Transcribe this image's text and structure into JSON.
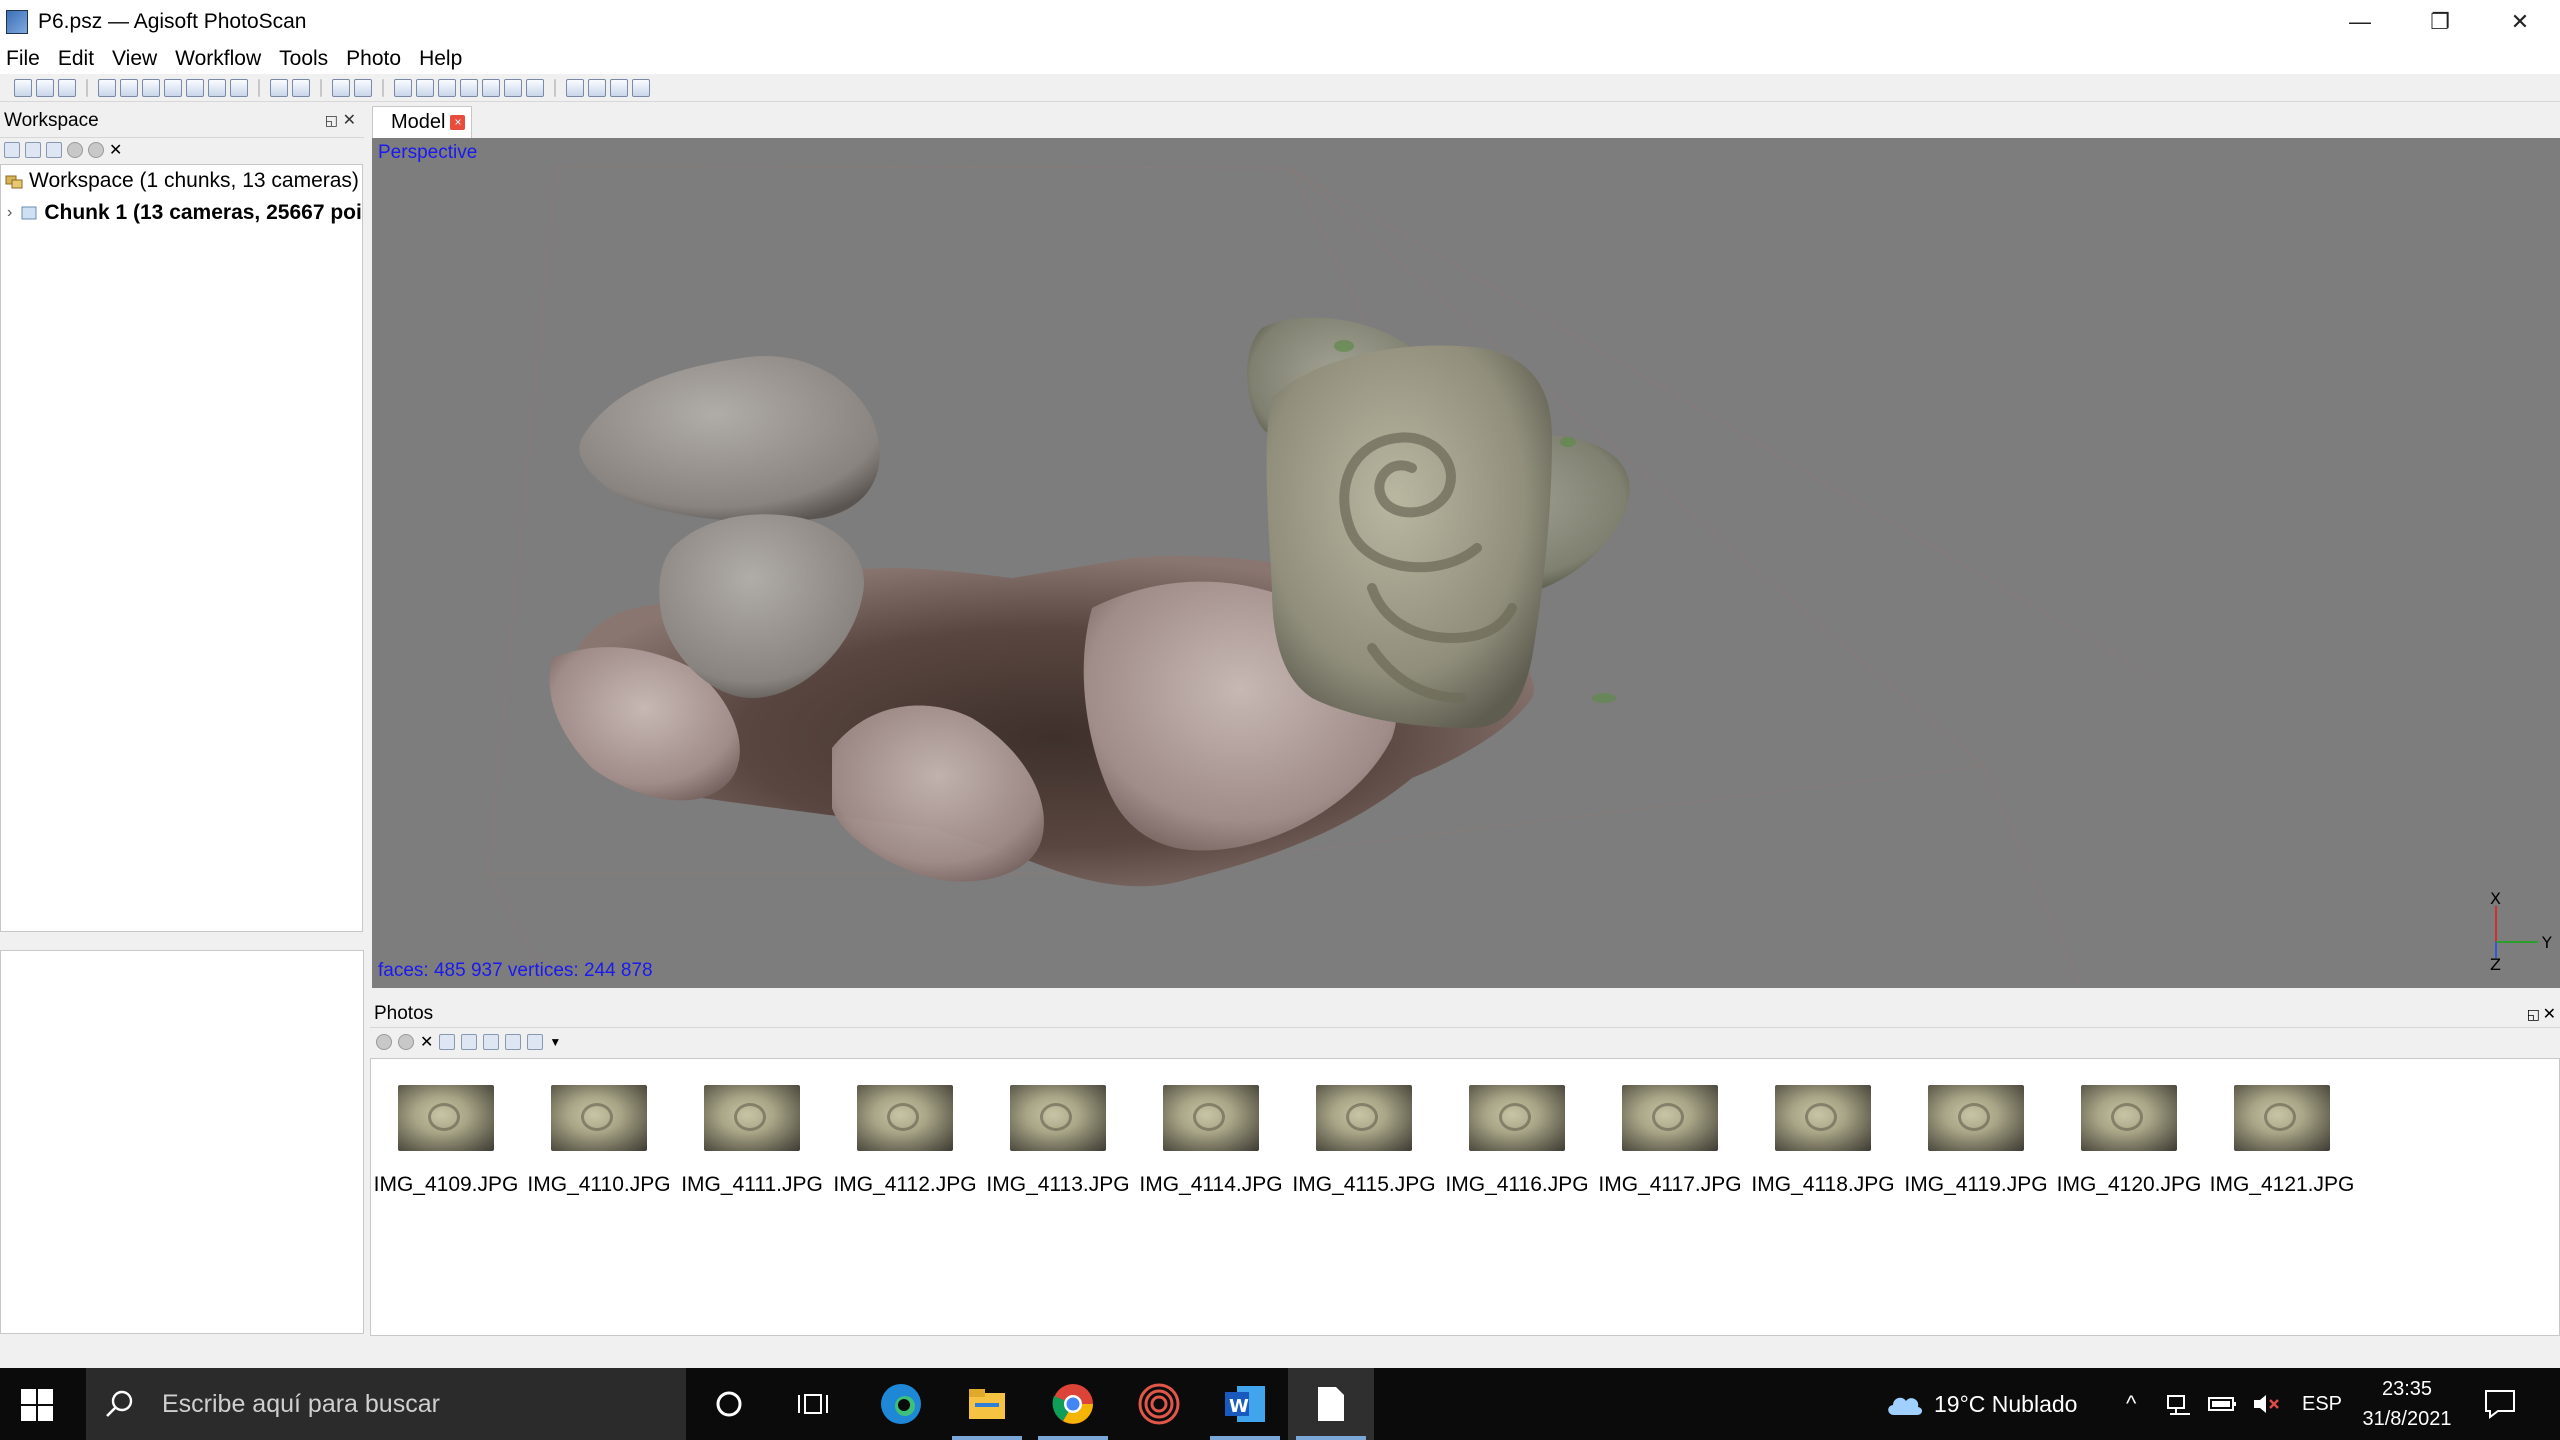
{
  "window": {
    "title": "P6.psz — Agisoft PhotoScan",
    "controls": [
      "—",
      "❐",
      "✕"
    ]
  },
  "menu": [
    "File",
    "Edit",
    "View",
    "Workflow",
    "Tools",
    "Photo",
    "Help"
  ],
  "workspace": {
    "header": "Workspace",
    "root_label": "Workspace (1 chunks, 13 cameras)",
    "chunk_label": "Chunk 1 (13 cameras, 25667 poi"
  },
  "model_tab": {
    "label": "Model"
  },
  "viewport": {
    "projection": "Perspective",
    "stats": "faces: 485 937 vertices: 244 878",
    "axes": {
      "x": "X",
      "y": "Y",
      "z": "Z"
    }
  },
  "photos": {
    "header": "Photos",
    "items": [
      "IMG_4109.JPG",
      "IMG_4110.JPG",
      "IMG_4111.JPG",
      "IMG_4112.JPG",
      "IMG_4113.JPG",
      "IMG_4114.JPG",
      "IMG_4115.JPG",
      "IMG_4116.JPG",
      "IMG_4117.JPG",
      "IMG_4118.JPG",
      "IMG_4119.JPG",
      "IMG_4120.JPG",
      "IMG_4121.JPG"
    ]
  },
  "taskbar": {
    "search_placeholder": "Escribe aquí para buscar",
    "weather": "19°C  Nublado",
    "language": "ESP",
    "time": "23:35",
    "date": "31/8/2021"
  },
  "colors": {
    "viewport_bg": "#7d7d7d",
    "overlay_text": "#1a1aee",
    "taskbar_bg": "#0b0b0b"
  }
}
